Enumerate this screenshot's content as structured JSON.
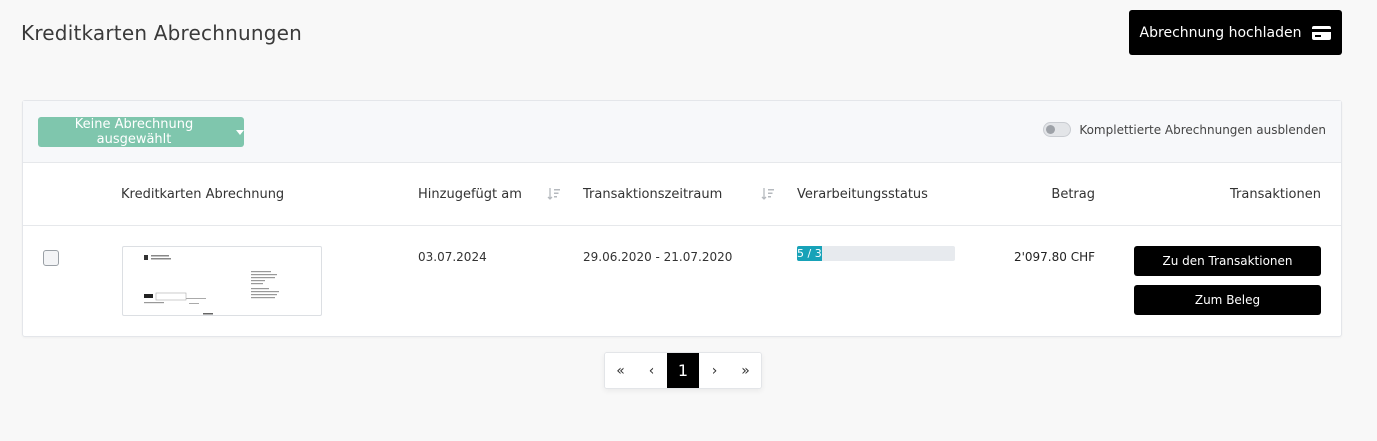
{
  "header": {
    "title": "Kreditkarten Abrechnungen",
    "upload_label": "Abrechnung hochladen",
    "upload_icon": "credit-card-icon"
  },
  "filter": {
    "select_label": "Keine Abrechnung ausgewählt",
    "toggle_label": "Komplettierte Abrechnungen ausblenden",
    "toggle_on": false
  },
  "table": {
    "columns": {
      "statement": "Kreditkarten Abrechnung",
      "added": "Hinzugefügt am",
      "period": "Transaktionszeitraum",
      "status": "Verarbeitungsstatus",
      "amount": "Betrag",
      "transactions": "Transaktionen"
    },
    "rows": [
      {
        "added": "03.07.2024",
        "period": "29.06.2020 - 21.07.2020",
        "progress_text": "5 / 32",
        "progress_fraction": 0.156,
        "amount": "2'097.80 CHF",
        "btn_transactions": "Zu den Transaktionen",
        "btn_receipt": "Zum Beleg"
      }
    ]
  },
  "pagination": {
    "first": "«",
    "prev": "‹",
    "current": "1",
    "next": "›",
    "last": "»"
  },
  "colors": {
    "accent_select": "#7fc6ad",
    "progress": "#17a2b8",
    "primary_button": "#000000"
  }
}
